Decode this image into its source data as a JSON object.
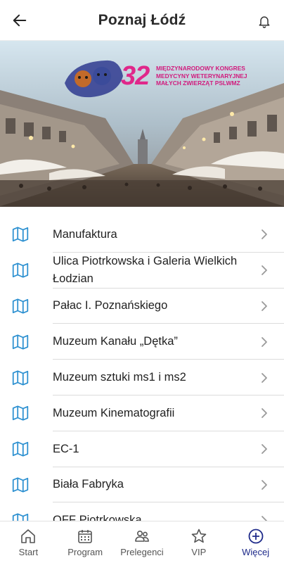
{
  "header": {
    "title": "Poznaj Łódź",
    "back_icon": "arrow-left-icon",
    "bell_icon": "bell-icon"
  },
  "banner": {
    "number": "32",
    "line1": "MIĘDZYNARODOWY KONGRES",
    "line2": "MEDYCYNY WETERYNARYJNEJ",
    "line3": "MAŁYCH ZWIERZĄT PSLWMZ"
  },
  "places": [
    {
      "label": "Manufaktura"
    },
    {
      "label": "Ulica Piotrkowska i Galeria Wielkich Łodzian"
    },
    {
      "label": "Pałac I. Poznańskiego"
    },
    {
      "label": "Muzeum Kanału „Dętka”"
    },
    {
      "label": "Muzeum sztuki ms1 i ms2"
    },
    {
      "label": "Muzeum Kinematografii"
    },
    {
      "label": "EC-1"
    },
    {
      "label": "Biała Fabryka"
    },
    {
      "label": "OFF Piotrkowska"
    }
  ],
  "tabs": [
    {
      "label": "Start",
      "icon": "home-icon"
    },
    {
      "label": "Program",
      "icon": "calendar-icon"
    },
    {
      "label": "Prelegenci",
      "icon": "people-icon"
    },
    {
      "label": "VIP",
      "icon": "star-icon"
    },
    {
      "label": "Więcej",
      "icon": "plus-circle-icon",
      "active": true
    }
  ],
  "colors": {
    "accent": "#1e2a8a",
    "map_icon": "#2a8fd0",
    "brand_pink": "#e0278a"
  }
}
